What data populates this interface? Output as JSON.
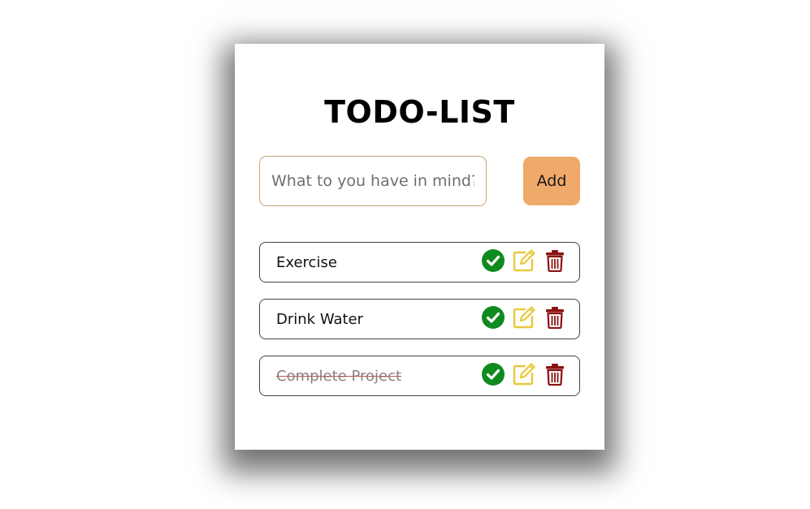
{
  "app": {
    "title": "TODO-LIST"
  },
  "input": {
    "placeholder": "What to you have in mind?",
    "value": ""
  },
  "add_button": {
    "label": "Add",
    "color": "#efa96a"
  },
  "todos": [
    {
      "text": "Exercise",
      "completed": false
    },
    {
      "text": "Drink Water",
      "completed": false
    },
    {
      "text": "Complete Project",
      "completed": true
    }
  ],
  "icons": {
    "complete": "check-circle-icon",
    "edit": "edit-icon",
    "delete": "trash-icon"
  },
  "colors": {
    "complete": "#0f8a1f",
    "edit": "#e8c93a",
    "delete": "#8b1111"
  }
}
